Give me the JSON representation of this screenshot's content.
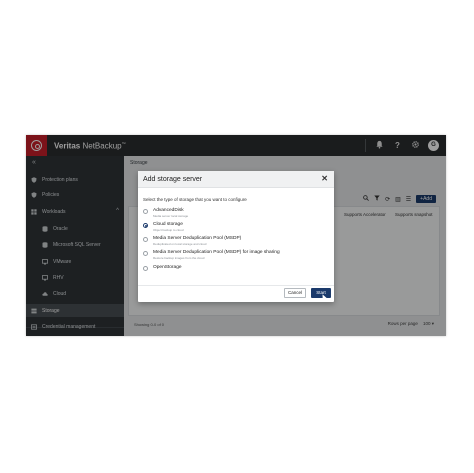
{
  "header": {
    "brand_bold": "Veritas",
    "brand_light": "NetBackup",
    "brand_tm": "™",
    "avatar_initial": "G"
  },
  "sidebar": {
    "items": [
      {
        "label": "Protection plans",
        "icon": "shield-icon"
      },
      {
        "label": "Policies",
        "icon": "shield-icon"
      },
      {
        "label": "Workloads",
        "icon": "workloads-icon"
      },
      {
        "label": "Oracle",
        "icon": "database-icon"
      },
      {
        "label": "Microsoft SQL Server",
        "icon": "database-icon"
      },
      {
        "label": "VMware",
        "icon": "vm-icon"
      },
      {
        "label": "RHV",
        "icon": "vm-icon"
      },
      {
        "label": "Cloud",
        "icon": "cloud-icon"
      },
      {
        "label": "Storage",
        "icon": "storage-icon"
      },
      {
        "label": "Credential management",
        "icon": "key-icon"
      }
    ]
  },
  "content": {
    "breadcrumb": "Storage",
    "add_label": "+Add",
    "columns": [
      "Supports Accelerator",
      "Supports snapshot"
    ],
    "footer_left": "Showing 0-0 of 0",
    "rows_per_page_label": "Rows per page",
    "rows_per_page_value": "100"
  },
  "modal": {
    "title": "Add storage server",
    "prompt": "Select the type of storage that you want to configure",
    "options": [
      {
        "label": "AdvancedDisk",
        "desc": "Media server local storage",
        "checked": false
      },
      {
        "label": "Cloud storage",
        "desc": "Object backup to cloud",
        "checked": true
      },
      {
        "label": "Media Server Deduplication Pool (MSDP)",
        "desc": "Deduplicated on local storage and cloud",
        "checked": false
      },
      {
        "label": "Media Server Deduplication Pool (MSDP) for image sharing",
        "desc": "Restore backup images from the cloud",
        "checked": false
      },
      {
        "label": "OpenStorage",
        "desc": "",
        "checked": false
      }
    ],
    "cancel_label": "Cancel",
    "start_label": "Start"
  }
}
